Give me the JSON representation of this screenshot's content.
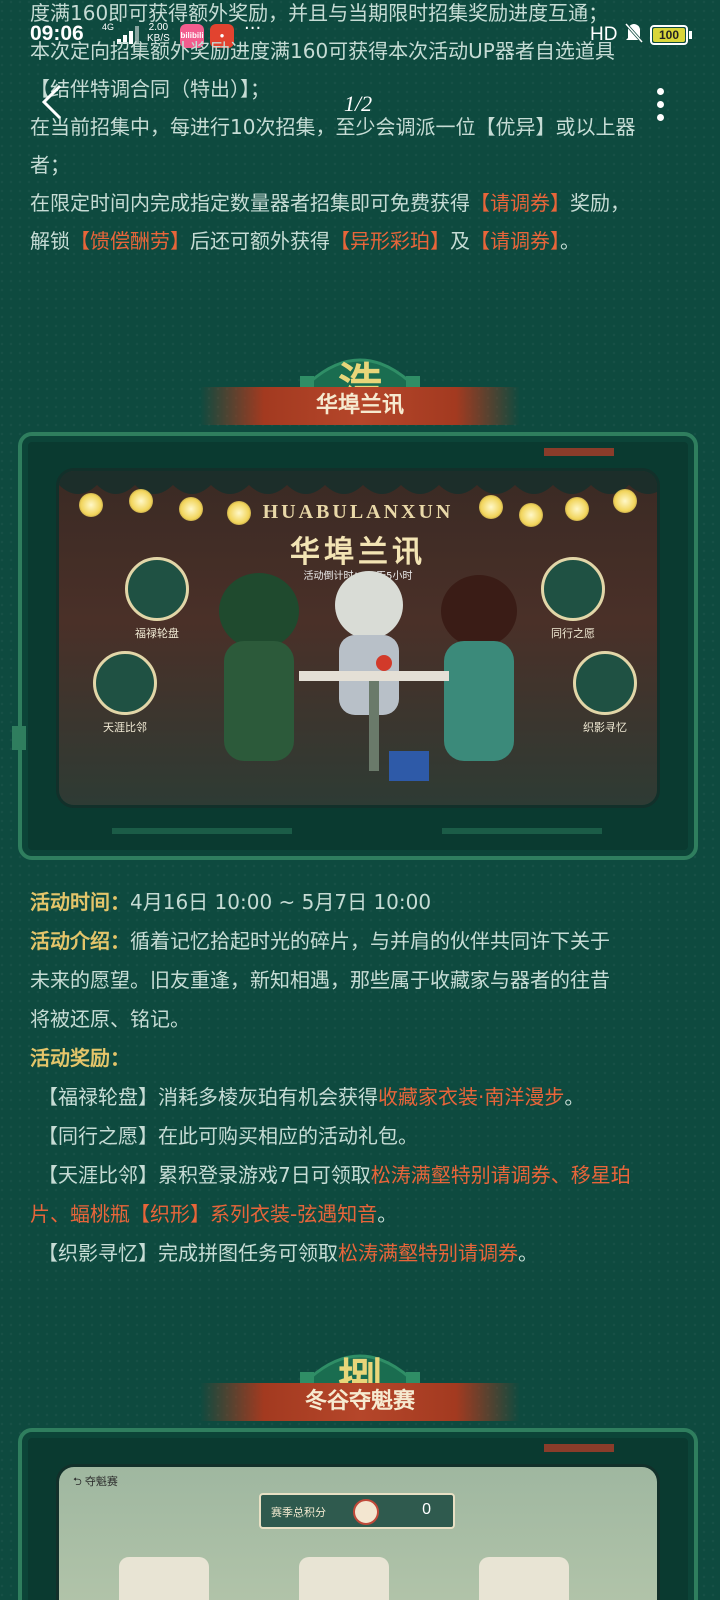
{
  "status": {
    "time": "09:06",
    "network": "4G",
    "speed_value": "2.00",
    "speed_unit": "KB/S",
    "app1": "bilibili",
    "more": "···",
    "hd": "HD",
    "battery": "100"
  },
  "nav": {
    "page_indicator": "1/2"
  },
  "intro": {
    "line1": "度满160即可获得额外奖励，并且与当期限时招集奖励进度互通；",
    "line2": "本次定向招集额外奖励进度满160可获得本次活动UP器者自选道具",
    "line3": "【结伴特调合同（特出）】；",
    "line4": "在当前招集中，每进行10次招集，至少会调派一位【优异】或以上器",
    "line5": "者；",
    "line6_a": "在限定时间内完成指定数量器者招集即可免费获得",
    "line6_hl": "【请调券】",
    "line6_b": "奖励，",
    "line7_a": "解锁",
    "line7_hl1": "【馈偿酬劳】",
    "line7_b": "后还可额外获得",
    "line7_hl2": "【异形彩珀】",
    "line7_c": "及",
    "line7_hl3": "【请调券】",
    "line7_d": "。"
  },
  "section1": {
    "emblem": "浩",
    "title": "华埠兰讯",
    "banner": {
      "title_en": "HUABULANXUN",
      "title_cn": "华埠兰讯",
      "countdown": "活动倒计时：20天5小时",
      "btn_tl": "福禄轮盘",
      "btn_tr": "同行之愿",
      "btn_bl": "天涯比邻",
      "btn_br": "织影寻忆"
    }
  },
  "details": {
    "time_label": "活动时间：",
    "time_value": "4月16日 10:00 ~ 5月7日 10:00",
    "intro_label": "活动介绍：",
    "intro_l1": "循着记忆拾起时光的碎片，与并肩的伙伴共同许下关于",
    "intro_l2": "未来的愿望。旧友重逢，新知相遇，那些属于收藏家与器者的往昔",
    "intro_l3": "将被还原、铭记。",
    "reward_label": "活动奖励：",
    "r1_a": "【福禄轮盘】消耗多棱灰珀有机会获得",
    "r1_hl": "收藏家衣装·南洋漫步",
    "r1_b": "。",
    "r2": "【同行之愿】在此可购买相应的活动礼包。",
    "r3_a": "【天涯比邻】累积登录游戏7日可领取",
    "r3_hl1": "松涛满壑特别请调券、移星珀",
    "r3_hl2": "片、蝠桃瓶【织形】系列衣装-弦遇知音",
    "r3_b": "。",
    "r4_a": "【织影寻忆】完成拼图任务可领取",
    "r4_hl": "松涛满壑特别请调券",
    "r4_b": "。"
  },
  "section2": {
    "emblem": "捌",
    "title": "冬谷夺魁赛",
    "banner": {
      "back": "夺魁赛",
      "score_label": "赛季总积分",
      "score_value": "0"
    }
  },
  "colors": {
    "background": "#0e4a3f",
    "highlight": "#e8653a",
    "label": "#e4c56a",
    "text": "#c6dcd5"
  }
}
